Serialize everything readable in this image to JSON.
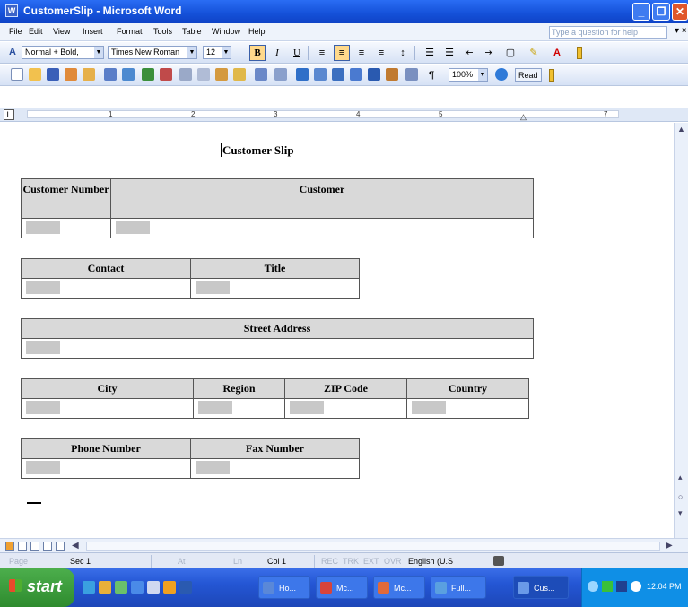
{
  "window": {
    "title": "CustomerSlip - Microsoft Word",
    "app_icon": "W"
  },
  "menu": {
    "items": [
      "File",
      "Edit",
      "View",
      "Insert",
      "Format",
      "Tools",
      "Table",
      "Window",
      "Help"
    ],
    "help_placeholder": "Type a question for help",
    "close_doc": "▾ ×"
  },
  "formatting": {
    "style": "Normal + Bold,",
    "font": "Times New Roman",
    "size": "12",
    "bold": "B",
    "italic": "I",
    "underline": "U"
  },
  "standard": {
    "zoom": "100%",
    "read": "Read"
  },
  "ruler": {
    "numbers": [
      "1",
      "2",
      "3",
      "4",
      "5",
      "7"
    ]
  },
  "document": {
    "title": "Customer Slip",
    "tables": {
      "customer": {
        "headers": [
          "Customer Number",
          "Customer"
        ]
      },
      "contact": {
        "headers": [
          "Contact",
          "Title"
        ]
      },
      "street": {
        "headers": [
          "Street Address"
        ]
      },
      "city": {
        "headers": [
          "City",
          "Region",
          "ZIP Code",
          "Country"
        ]
      },
      "phone": {
        "headers": [
          "Phone Number",
          "Fax Number"
        ]
      }
    }
  },
  "status": {
    "page": "Page",
    "sec": "Sec 1",
    "at": "At",
    "ln": "Ln",
    "col": "Col 1",
    "rec": "REC",
    "trk": "TRK",
    "ext": "EXT",
    "ovr": "OVR",
    "lang": "English (U.S"
  },
  "taskbar": {
    "start": "start",
    "tasks": [
      "Ho...",
      "Mc...",
      "Mc...",
      "Full...",
      "Cus..."
    ],
    "clock": "12:04 PM"
  },
  "colors": {
    "title_bar": "#1450d8",
    "header_fill": "#d9d9d9",
    "field_shade": "#c8c8c8",
    "start_green": "#3a9c3a"
  }
}
